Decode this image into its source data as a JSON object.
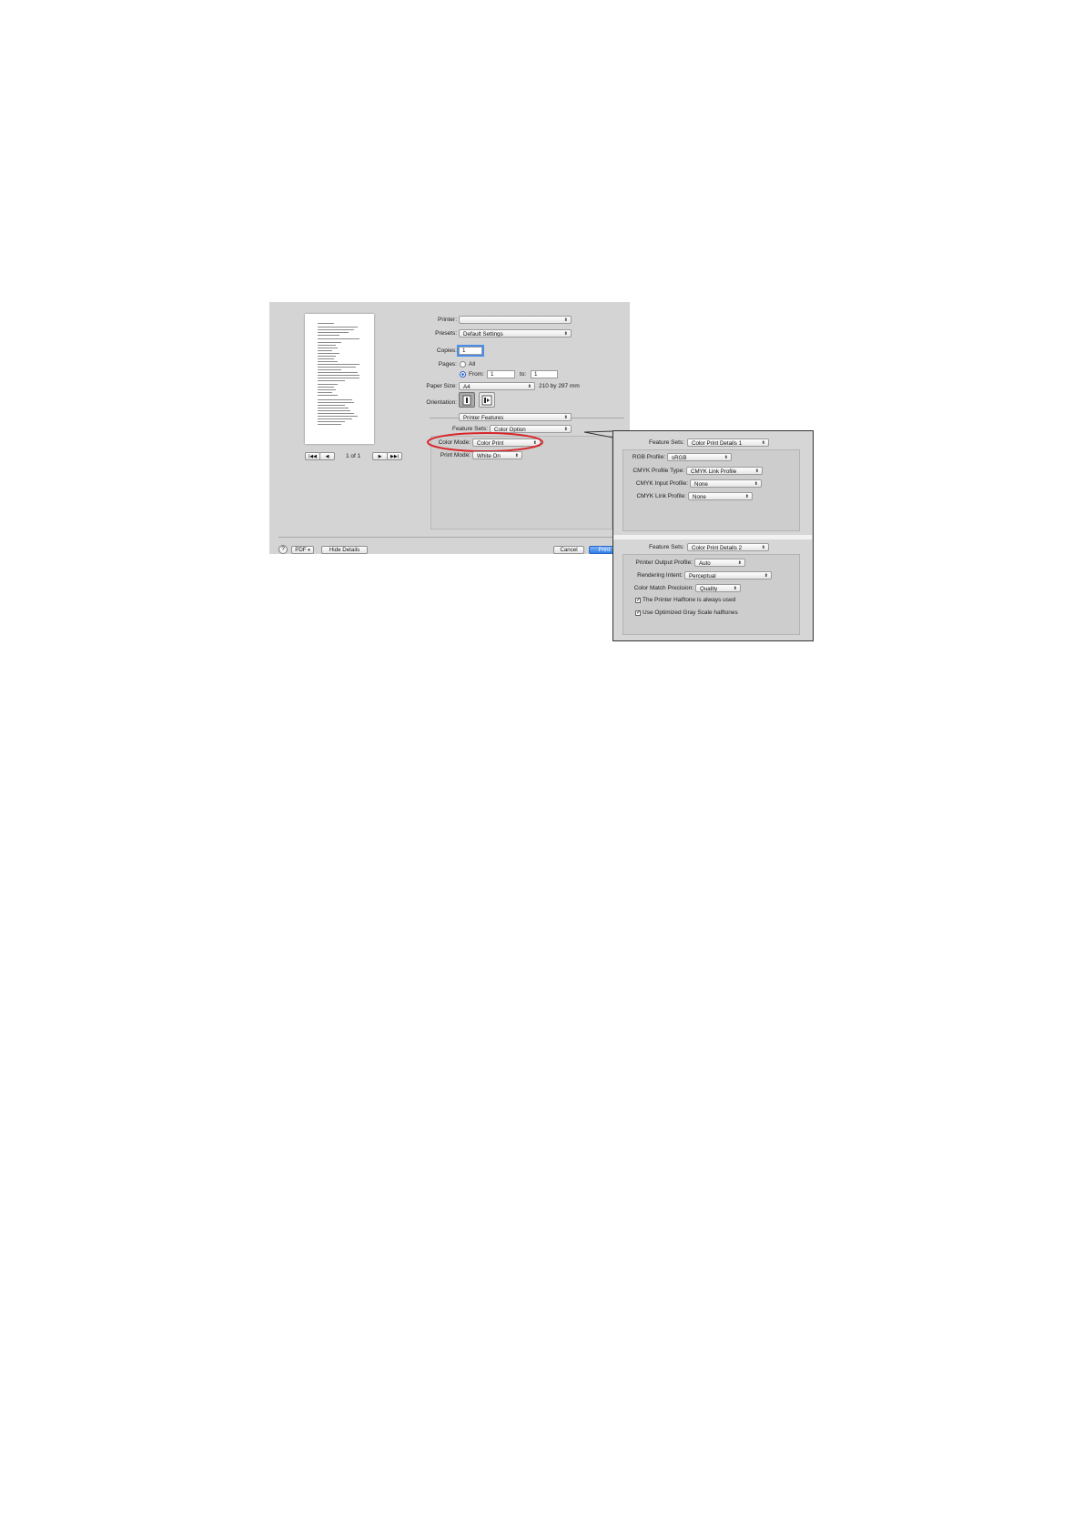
{
  "preview": {
    "page_counter": "1 of 1"
  },
  "form": {
    "printer_label": "Printer:",
    "printer_value": "",
    "presets_label": "Presets:",
    "presets_value": "Default Settings",
    "copies_label": "Copies:",
    "copies_value": "1",
    "pages_label": "Pages:",
    "pages_all": "All",
    "pages_from": "From:",
    "pages_from_value": "1",
    "pages_to": "to:",
    "pages_to_value": "1",
    "paper_size_label": "Paper Size:",
    "paper_size_value": "A4",
    "paper_size_dims": "210 by 297 mm",
    "orientation_label": "Orientation:",
    "section_value": "Printer Features",
    "feature_sets_label": "Feature Sets:",
    "feature_sets_value": "Color Option",
    "color_mode_label": "Color Mode:",
    "color_mode_value": "Color Print",
    "print_mode_label": "Print Mode:",
    "print_mode_value": "White On"
  },
  "bottom_bar": {
    "help": "?",
    "pdf": "PDF",
    "hide_details": "Hide Details",
    "cancel": "Cancel",
    "print": "Print"
  },
  "callout": {
    "pane1": {
      "feature_sets_label": "Feature Sets:",
      "feature_sets_value": "Color Print Details 1",
      "rgb_profile_label": "RGB Profile:",
      "rgb_profile_value": "sRGB",
      "cmyk_profile_type_label": "CMYK Profile Type:",
      "cmyk_profile_type_value": "CMYK Link Profile",
      "cmyk_input_label": "CMYK Input Profile:",
      "cmyk_input_value": "None",
      "cmyk_link_label": "CMYK Link Profile:",
      "cmyk_link_value": "None"
    },
    "pane2": {
      "feature_sets_label": "Feature Sets:",
      "feature_sets_value": "Color Print Details 2",
      "output_profile_label": "Printer Output Profile:",
      "output_profile_value": "Auto",
      "rendering_intent_label": "Rendering Intent:",
      "rendering_intent_value": "Perceptual",
      "precision_label": "Color Match Precision:",
      "precision_value": "Quality",
      "halftone_label": "The Printer Halftone is always used",
      "gray_label": "Use Optimized Gray Scale halftones"
    }
  },
  "colors": {
    "highlight_ring": "#d8262a",
    "focus_blue": "#4a8ee8"
  }
}
